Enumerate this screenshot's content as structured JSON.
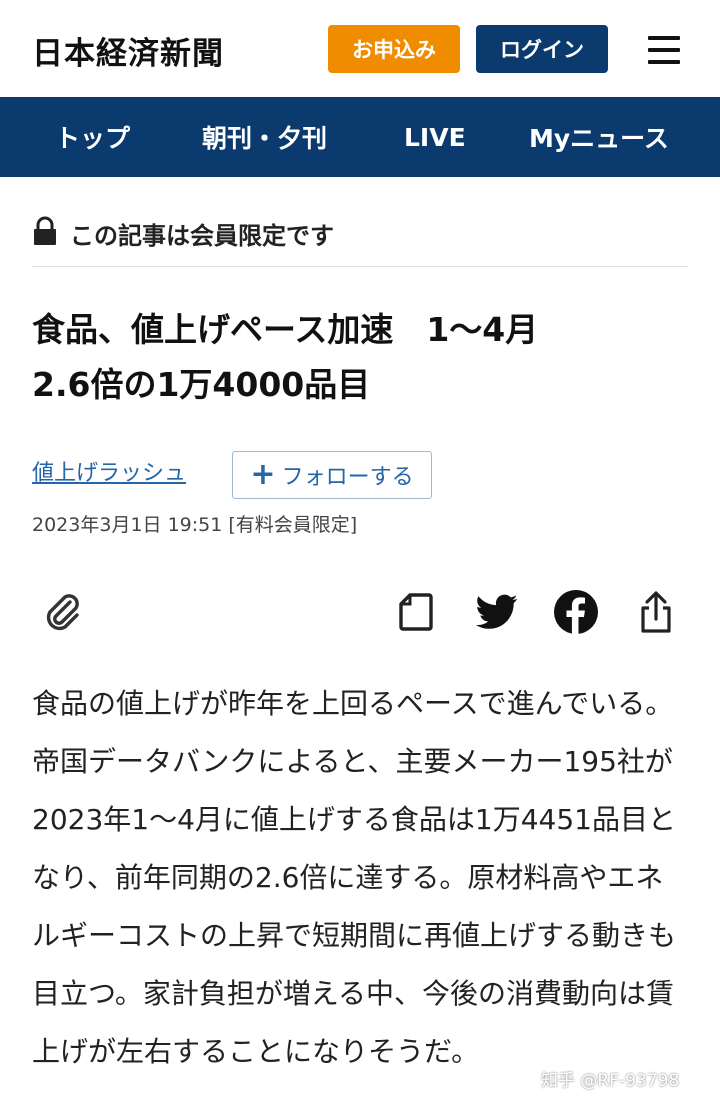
{
  "header": {
    "logo": "日本経済新聞",
    "apply_label": "お申込み",
    "login_label": "ログイン",
    "menu_icon": "hamburger-icon"
  },
  "nav": {
    "items": [
      {
        "label": "トップ"
      },
      {
        "label": "朝刊・夕刊"
      },
      {
        "label": "LIVE"
      },
      {
        "label": "Myニュース"
      }
    ]
  },
  "article": {
    "member_notice": "この記事は会員限定です",
    "headline": "食品、値上げペース加速　1〜4月\n2.6倍の1万4000品目",
    "topic": "値上げラッシュ",
    "follow_label": "フォローする",
    "meta": "2023年3月1日 19:51 [有料会員限定]",
    "body": "食品の値上げが昨年を上回るペースで進んでいる。帝国データバンクによると、主要メーカー195社が2023年1〜4月に値上げする食品は1万4451品目となり、前年同期の2.6倍に達する。原材料高やエネルギーコストの上昇で短期間に再値上げする動きも目立つ。家計負担が増える中、今後の消費動向は賃上げが左右することになりそうだ。"
  },
  "actions": {
    "icons": [
      "paperclip-icon",
      "save-icon",
      "twitter-icon",
      "facebook-icon",
      "share-icon"
    ]
  },
  "watermark": "知乎 @RF-93798",
  "colors": {
    "brand_navy": "#0b3a6e",
    "accent_orange": "#f08c00",
    "link_blue": "#2565a8"
  }
}
